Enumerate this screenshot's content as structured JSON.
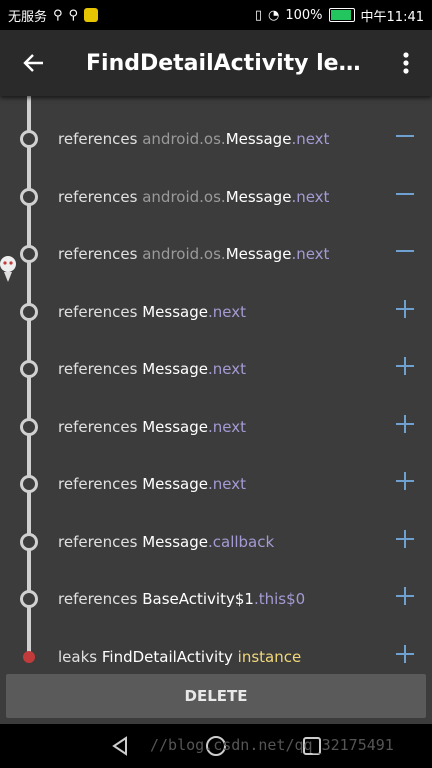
{
  "status_bar": {
    "left_text": "无服务",
    "battery": "100%",
    "time": "中午11:41"
  },
  "toolbar": {
    "title": "FindDetailActivity leaked…"
  },
  "rows": [
    {
      "prefix": "references",
      "package": "android.os.",
      "class": "Message",
      "field": ".next",
      "toggle": "minus"
    },
    {
      "prefix": "references",
      "package": "android.os.",
      "class": "Message",
      "field": ".next",
      "toggle": "minus"
    },
    {
      "prefix": "references",
      "package": "android.os.",
      "class": "Message",
      "field": ".next",
      "toggle": "minus"
    },
    {
      "prefix": "references",
      "package": "",
      "class": "Message",
      "field": ".next",
      "toggle": "plus"
    },
    {
      "prefix": "references",
      "package": "",
      "class": "Message",
      "field": ".next",
      "toggle": "plus"
    },
    {
      "prefix": "references",
      "package": "",
      "class": "Message",
      "field": ".next",
      "toggle": "plus"
    },
    {
      "prefix": "references",
      "package": "",
      "class": "Message",
      "field": ".next",
      "toggle": "plus"
    },
    {
      "prefix": "references",
      "package": "",
      "class": "Message",
      "field": ".callback",
      "toggle": "plus"
    },
    {
      "prefix": "references",
      "package": "",
      "class": "BaseActivity$1",
      "field": ".this$0",
      "toggle": "plus"
    }
  ],
  "leak_row": {
    "prefix": "leaks",
    "class": "FindDetailActivity",
    "suffix": "instance",
    "toggle": "plus"
  },
  "delete_label": "DELETE",
  "watermark": "//blog.csdn.net/qq_32175491"
}
